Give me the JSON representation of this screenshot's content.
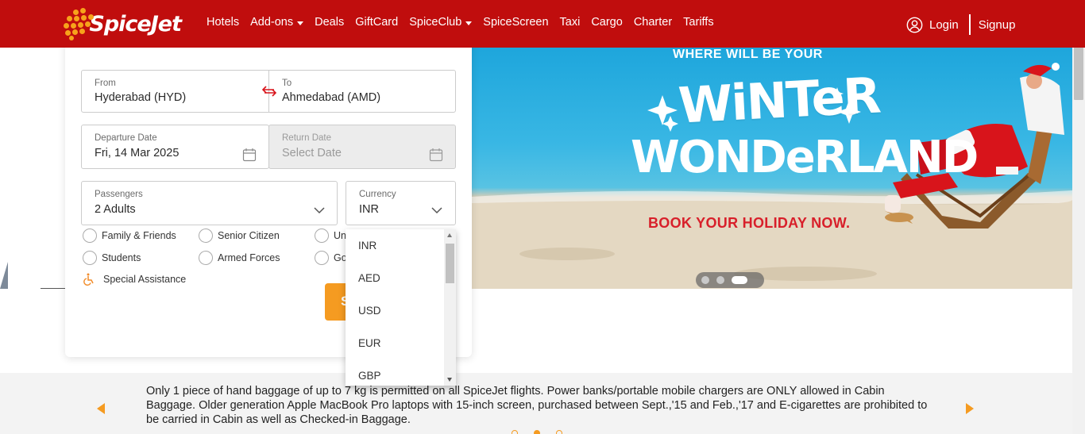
{
  "brand": {
    "logo_text": "SpiceJet",
    "primary_color": "#c00d0d",
    "accent_color": "#f59b21"
  },
  "nav": {
    "items": [
      {
        "label": "Hotels",
        "has_caret": false
      },
      {
        "label": "Add-ons",
        "has_caret": true
      },
      {
        "label": "Deals",
        "has_caret": false
      },
      {
        "label": "GiftCard",
        "has_caret": false
      },
      {
        "label": "SpiceClub",
        "has_caret": true
      },
      {
        "label": "SpiceScreen",
        "has_caret": false
      },
      {
        "label": "Taxi",
        "has_caret": false
      },
      {
        "label": "Cargo",
        "has_caret": false
      },
      {
        "label": "Charter",
        "has_caret": false
      },
      {
        "label": "Tariffs",
        "has_caret": false
      }
    ],
    "login": "Login",
    "signup": "Signup",
    "user_icon": "user-circle-icon"
  },
  "banner": {
    "line1": "WHERE WILL BE YOUR",
    "line2": "WiNTeR",
    "line3": "WONDeRLAND",
    "line4": "BOOK YOUR HOLIDAY NOW.",
    "slides_total": 3,
    "active_slide": 3
  },
  "booking": {
    "from": {
      "label": "From",
      "value": "Hyderabad (HYD)"
    },
    "to": {
      "label": "To",
      "value": "Ahmedabad (AMD)"
    },
    "departure": {
      "label": "Departure Date",
      "value": "Fri, 14 Mar 2025"
    },
    "return": {
      "label": "Return Date",
      "placeholder": "Select Date"
    },
    "passengers": {
      "label": "Passengers",
      "value": "2 Adults"
    },
    "currency": {
      "label": "Currency",
      "value": "INR",
      "options": [
        "INR",
        "AED",
        "USD",
        "EUR",
        "GBP"
      ]
    },
    "fare_types": {
      "col1": [
        "Family & Friends",
        "Students"
      ],
      "col2": [
        "Senior Citizen",
        "Armed Forces"
      ],
      "col3": [
        "Un",
        "Go"
      ]
    },
    "special_assistance": "Special Assistance",
    "search_label": "S"
  },
  "notice": {
    "text": "Only 1 piece of hand baggage of up to 7 kg is permitted on all SpiceJet flights. Power banks/portable mobile chargers are ONLY allowed in Cabin Baggage. Older generation Apple MacBook Pro laptops with 15-inch screen, purchased between Sept.,'15 and Feb.,'17 and E-cigarettes are prohibited to be carried in Cabin as well as Checked-in Baggage.",
    "slides_total": 3,
    "active_slide": 2
  }
}
